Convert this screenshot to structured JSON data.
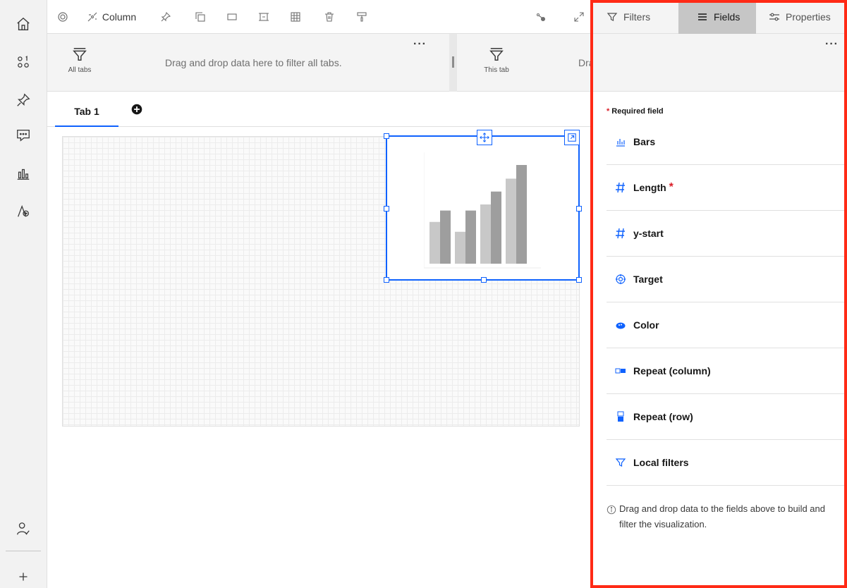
{
  "toolbar": {
    "chart_type_label": "Column"
  },
  "filters": {
    "all_tabs_label": "All tabs",
    "all_tabs_hint": "Drag and drop data here to filter all tabs.",
    "this_tab_label": "This tab",
    "this_tab_hint": "Drag and drop data here to filter this tab.",
    "more": "···"
  },
  "tabs": [
    {
      "label": "Tab 1",
      "active": true
    }
  ],
  "widget": {
    "bar_values": [
      55,
      70,
      42,
      70,
      78,
      95,
      112,
      130
    ],
    "bar_colors": [
      "#c8c8c8",
      "#9e9e9e"
    ]
  },
  "panel": {
    "tabs": [
      {
        "label": "Filters",
        "icon": "filter-icon",
        "active": false
      },
      {
        "label": "Fields",
        "icon": "fields-icon",
        "active": true
      },
      {
        "label": "Properties",
        "icon": "sliders-icon",
        "active": false
      }
    ],
    "required_text": "Required field",
    "fields": [
      {
        "label": "Bars",
        "icon": "bar-chart-icon",
        "required": false
      },
      {
        "label": "Length",
        "icon": "hash-icon",
        "required": true
      },
      {
        "label": "y-start",
        "icon": "hash-icon",
        "required": false
      },
      {
        "label": "Target",
        "icon": "target-icon",
        "required": false
      },
      {
        "label": "Color",
        "icon": "palette-icon",
        "required": false
      },
      {
        "label": "Repeat (column)",
        "icon": "repeat-column-icon",
        "required": false
      },
      {
        "label": "Repeat (row)",
        "icon": "repeat-row-icon",
        "required": false
      },
      {
        "label": "Local filters",
        "icon": "filter-icon",
        "required": false
      }
    ],
    "info_text": "Drag and drop data to the fields above to build and filter the visualization."
  },
  "colors": {
    "accent": "#0f62fe",
    "highlight_outline": "#ff2a16",
    "required": "#da1e28"
  }
}
